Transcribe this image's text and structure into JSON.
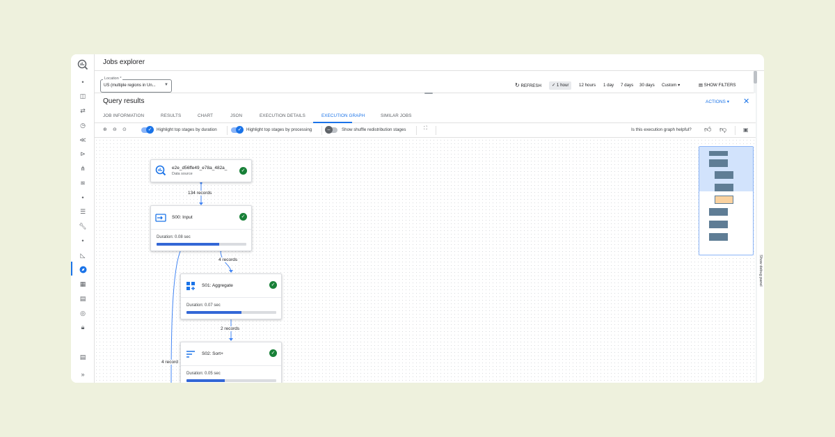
{
  "header": {
    "title": "Jobs explorer"
  },
  "location": {
    "label": "Location *",
    "value": "US (multiple regions in Un..."
  },
  "timebar": {
    "refresh_label": "REFRESH",
    "ranges": [
      "1 hour",
      "12 hours",
      "1 day",
      "7 days",
      "30 days"
    ],
    "selected_range": "1 hour",
    "custom_label": "Custom",
    "filters_label": "SHOW FILTERS"
  },
  "panel": {
    "title": "Query results",
    "actions_label": "ACTIONS",
    "tabs": [
      "JOB INFORMATION",
      "RESULTS",
      "CHART",
      "JSON",
      "EXECUTION DETAILS",
      "EXECUTION GRAPH",
      "SIMILAR JOBS"
    ],
    "active_tab": "EXECUTION GRAPH"
  },
  "toolbar": {
    "toggle_duration": "Highlight top stages by duration",
    "toggle_processing": "Highlight top stages by processing",
    "toggle_shuffle": "Show shuffle redistribution stages",
    "helpful": "Is this execution graph helpful?"
  },
  "graph": {
    "source": {
      "name": "e2e_d56ffe49_e78a_482a_",
      "sub": "Data source"
    },
    "stages": [
      {
        "title": "S00: Input",
        "duration": "Duration: 0.08 sec",
        "progress": 0.7
      },
      {
        "title": "S01: Aggregate",
        "duration": "Duration: 0.07 sec",
        "progress": 0.61
      },
      {
        "title": "S02: Sort+",
        "duration": "Duration: 0.05 sec",
        "progress": 0.43
      }
    ],
    "edges": [
      "134 records",
      "4 records",
      "2 records",
      "4 record"
    ]
  },
  "debug_panel_label": "Show debug panel",
  "colors": {
    "accent": "#1a73e8",
    "success": "#188038",
    "bar_fill": "#3367d6"
  }
}
